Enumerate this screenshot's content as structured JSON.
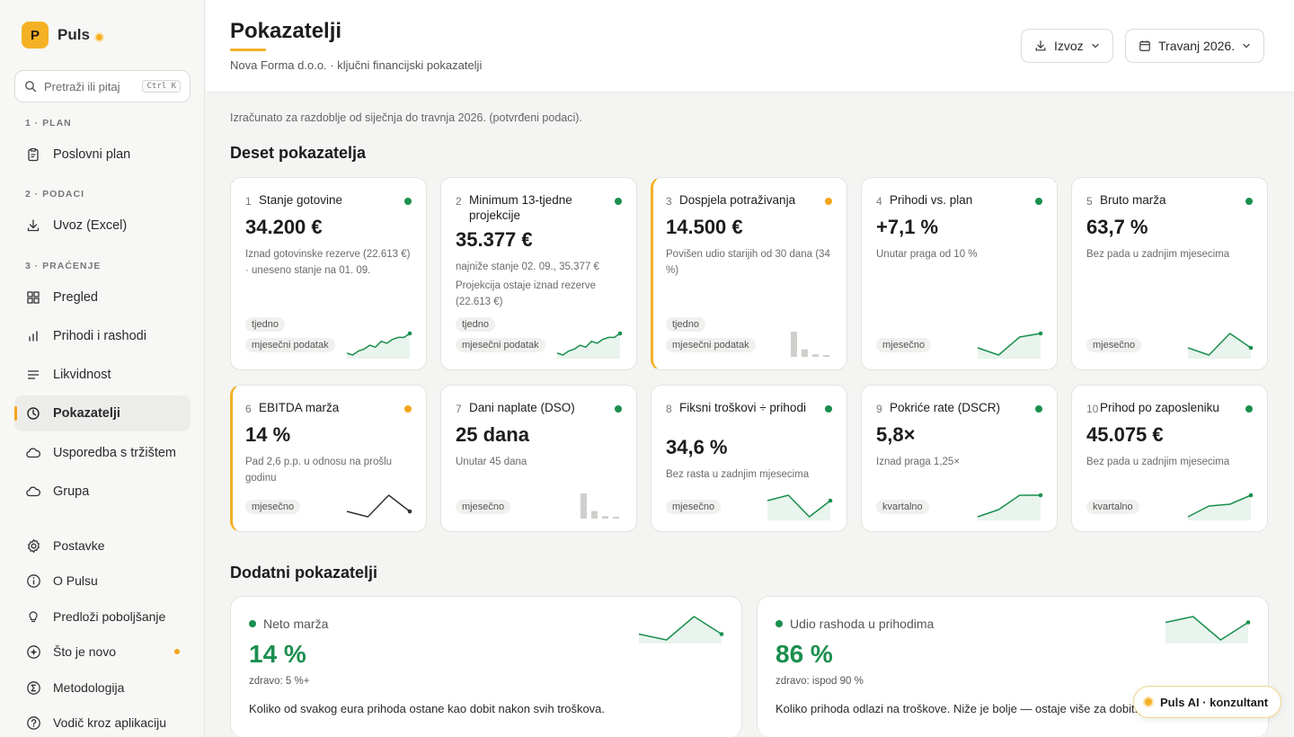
{
  "app": {
    "name": "Puls",
    "logo_letter": "P"
  },
  "search": {
    "placeholder": "Pretraži ili pitaj",
    "shortcut": "Ctrl K"
  },
  "sidebar": {
    "sections": [
      "1 · PLAN",
      "2 · PODACI",
      "3 · PRAĆENJE"
    ],
    "items": [
      {
        "label": "Poslovni plan",
        "icon": "clipboard-icon"
      },
      {
        "label": "Uvoz (Excel)",
        "icon": "download-icon"
      },
      {
        "label": "Pregled",
        "icon": "grid-icon"
      },
      {
        "label": "Prihodi i rashodi",
        "icon": "bar-chart-icon"
      },
      {
        "label": "Likvidnost",
        "icon": "lines-icon"
      },
      {
        "label": "Pokazatelji",
        "icon": "clock-icon",
        "active": true
      },
      {
        "label": "Usporedba s tržištem",
        "icon": "cloud-icon"
      },
      {
        "label": "Grupa",
        "icon": "cloud-icon"
      }
    ],
    "footer": [
      {
        "label": "Postavke",
        "icon": "gear-icon"
      },
      {
        "label": "O Pulsu",
        "icon": "info-icon"
      },
      {
        "label": "Predloži poboljšanje",
        "icon": "lightbulb-icon"
      },
      {
        "label": "Što je novo",
        "icon": "sparkle-icon"
      },
      {
        "label": "Metodologija",
        "icon": "sigma-icon"
      },
      {
        "label": "Vodič kroz aplikaciju",
        "icon": "help-icon"
      }
    ]
  },
  "header": {
    "title": "Pokazatelji",
    "subtitle": "Nova Forma d.o.o. · ključni financijski pokazatelji",
    "export_label": "Izvoz",
    "period_label": "Travanj 2026."
  },
  "note": "Izračunato za razdoblje od siječnja do travnja 2026. (potvrđeni podaci).",
  "section_title": "Deset pokazatelja",
  "colors": {
    "ok": "#1a8f4e",
    "warn": "#f4a51c",
    "accent": "#f4b125"
  },
  "cards": [
    {
      "num": "1",
      "title": "Stanje gotovine",
      "status": "ok",
      "value": "34.200 €",
      "desc": "Iznad gotovinske rezerve (22.613 €) · uneseno stanje na 01. 09.",
      "pills": [
        "tjedno",
        "mjesečni podatak"
      ],
      "spark": "line",
      "series": [
        3,
        2,
        4,
        5,
        7,
        6,
        9,
        8,
        10,
        11,
        11,
        13
      ]
    },
    {
      "num": "2",
      "title": "Minimum 13-tjedne projekcije",
      "status": "ok",
      "value": "35.377 €",
      "desc": "najniže stanje 02. 09., 35.377 €",
      "desc2": "Projekcija ostaje iznad rezerve (22.613 €)",
      "pills": [
        "tjedno",
        "mjesečni podatak"
      ],
      "spark": "line",
      "series": [
        3,
        2,
        4,
        5,
        7,
        6,
        9,
        8,
        10,
        11,
        11,
        13
      ]
    },
    {
      "num": "3",
      "title": "Dospjela potraživanja",
      "status": "warn",
      "value": "14.500 €",
      "desc": "Povišen udio starijih od 30 dana (34 %)",
      "pills": [
        "tjedno",
        "mjesečni podatak"
      ],
      "spark": "bars",
      "series": [
        20,
        6,
        2,
        1
      ]
    },
    {
      "num": "4",
      "title": "Prihodi vs. plan",
      "status": "ok",
      "value": "+7,1 %",
      "desc": "Unutar praga od 10 %",
      "pills": [
        "mjesečno"
      ],
      "spark": "line",
      "series": [
        3,
        1,
        6,
        7
      ]
    },
    {
      "num": "5",
      "title": "Bruto marža",
      "status": "ok",
      "value": "63,7 %",
      "desc": "Bez pada u zadnjim mjesecima",
      "pills": [
        "mjesečno"
      ],
      "spark": "line",
      "series": [
        5,
        4,
        7,
        5
      ]
    },
    {
      "num": "6",
      "title": "EBITDA marža",
      "status": "warn",
      "value": "14 %",
      "desc": "Pad 2,6 p.p. u odnosu na prošlu godinu",
      "pills": [
        "mjesečno"
      ],
      "spark": "line-dark",
      "series": [
        4,
        3,
        7,
        4
      ]
    },
    {
      "num": "7",
      "title": "Dani naplate (DSO)",
      "status": "ok",
      "value": "25 dana",
      "desc": "Unutar 45 dana",
      "pills": [
        "mjesečno"
      ],
      "spark": "bars",
      "series": [
        20,
        6,
        2,
        1
      ]
    },
    {
      "num": "8",
      "title": "Fiksni troškovi ÷ prihodi",
      "status": "ok",
      "value": "34,6 %",
      "desc": "Bez rasta u zadnjim mjesecima",
      "pills": [
        "mjesečno"
      ],
      "spark": "line",
      "series": [
        6,
        7,
        3,
        6
      ]
    },
    {
      "num": "9",
      "title": "Pokriće rate (DSCR)",
      "status": "ok",
      "value": "5,8×",
      "desc": "Iznad praga 1,25×",
      "pills": [
        "kvartalno"
      ],
      "spark": "line",
      "series": [
        2,
        4,
        8,
        8
      ]
    },
    {
      "num": "10",
      "title": "Prihod po zaposleniku",
      "status": "ok",
      "value": "45.075 €",
      "desc": "Bez pada u zadnjim mjesecima",
      "pills": [
        "kvartalno"
      ],
      "spark": "line",
      "series": [
        3,
        6,
        6.5,
        9
      ]
    }
  ],
  "section2_title": "Dodatni pokazatelji",
  "extra": [
    {
      "title": "Neto marža",
      "value": "14 %",
      "sub": "zdravo: 5 %+",
      "desc": "Koliko od svakog eura prihoda ostane kao dobit nakon svih troškova.",
      "series": [
        5,
        4,
        8,
        5
      ]
    },
    {
      "title": "Udio rashoda u prihodima",
      "value": "86 %",
      "sub": "zdravo: ispod 90 %",
      "desc": "Koliko prihoda odlazi na troškove. Niže je bolje — ostaje više za dobit.",
      "series": [
        7,
        8,
        4,
        7
      ]
    }
  ],
  "ai_button": "Puls AI · konzultant"
}
